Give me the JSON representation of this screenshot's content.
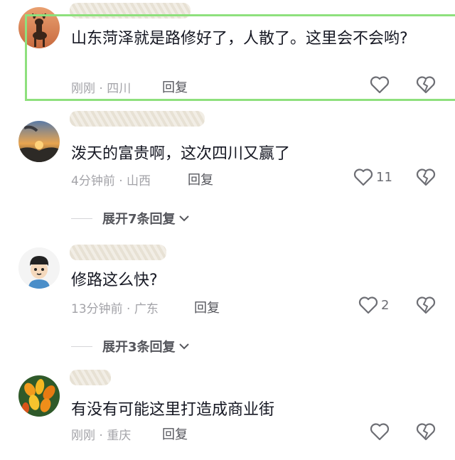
{
  "comments": [
    {
      "text": "山东菏泽就是路修好了，人散了。这里会不会哟?",
      "time_location": "刚刚 · 四川",
      "reply_label": "回复",
      "like_count": "",
      "avatar": "deer-avatar"
    },
    {
      "text": "泼天的富贵啊，这次四川又赢了",
      "time_location": "4分钟前 · 山西",
      "reply_label": "回复",
      "like_count": "11",
      "expand_label": "展开7条回复",
      "avatar": "sunset-avatar"
    },
    {
      "text": "修路这么快?",
      "time_location": "13分钟前 · 广东",
      "reply_label": "回复",
      "like_count": "2",
      "expand_label": "展开3条回复",
      "avatar": "cartoon-boy-avatar"
    },
    {
      "text": "有没有可能这里打造成商业街",
      "time_location": "刚刚 · 重庆",
      "reply_label": "回复",
      "like_count": "",
      "avatar": "fruit-avatar"
    }
  ],
  "colors": {
    "highlight_border": "#8ee07d",
    "text": "#161823",
    "meta": "#a3a3a8"
  }
}
